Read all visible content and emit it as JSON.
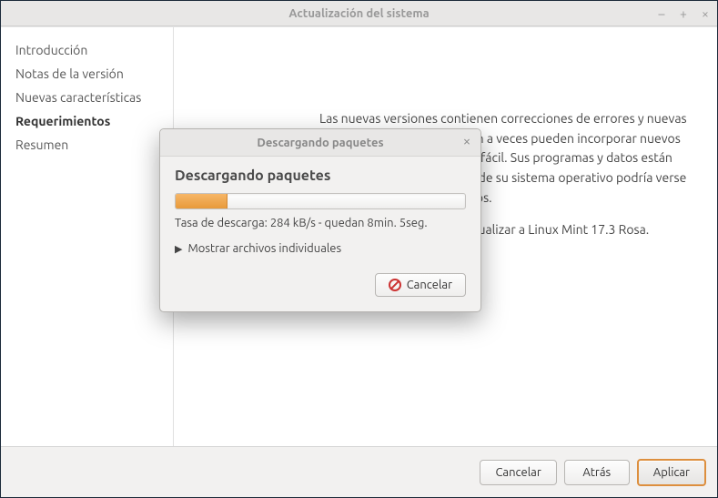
{
  "window": {
    "title": "Actualización del sistema"
  },
  "sidebar": {
    "items": [
      {
        "label": "Introducción",
        "active": false
      },
      {
        "label": "Notas de la versión",
        "active": false
      },
      {
        "label": "Nuevas características",
        "active": false
      },
      {
        "label": "Requerimientos",
        "active": true
      },
      {
        "label": "Resumen",
        "active": false
      }
    ]
  },
  "content": {
    "paragraph1": "Las nuevas versiones contienen correcciones de errores y nuevas características, pero también a veces pueden incorporar nuevos fallos. Actualizar siempre es fácil. Sus programas y datos están seguros, pero la estabilidad de su sistema operativo podría verse afectada por los nuevos fallos.",
    "paragraph2": "Haga clic en Aplicar para actualizar a Linux Mint 17.3 Rosa."
  },
  "footer": {
    "cancel": "Cancelar",
    "back": "Atrás",
    "apply": "Aplicar"
  },
  "dialog": {
    "title": "Descargando paquetes",
    "heading": "Descargando paquetes",
    "progress_percent": 18,
    "rate_text": "Tasa de descarga: 284 kB/s - quedan 8min. 5seg.",
    "expander_label": "Mostrar archivos individuales",
    "cancel_label": "Cancelar"
  }
}
